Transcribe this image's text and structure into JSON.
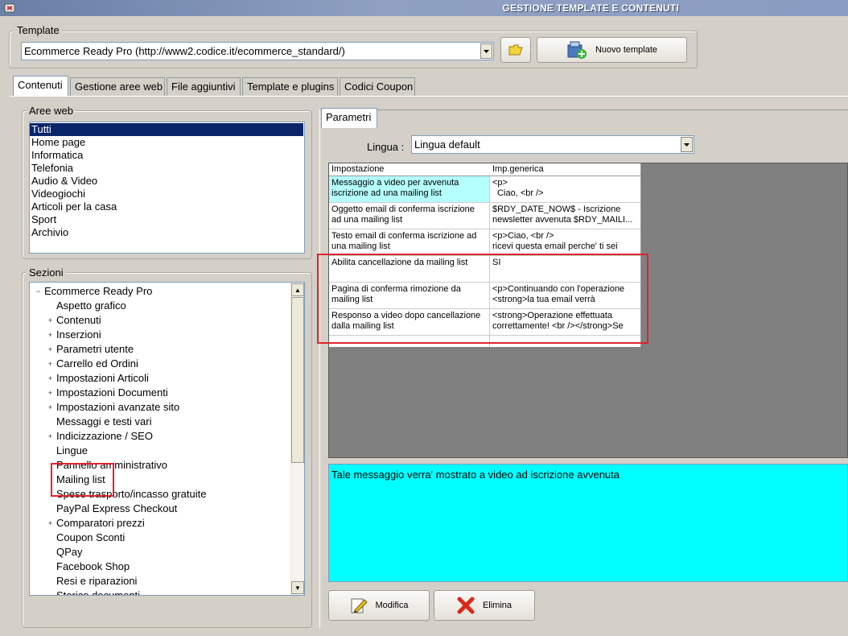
{
  "window": {
    "title": "GESTIONE TEMPLATE E CONTENUTI"
  },
  "template_group": {
    "label": "Template",
    "selected": "Ecommerce Ready Pro (http://www2.codice.it/ecommerce_standard/)",
    "new_button": "Nuovo template"
  },
  "tabs": [
    "Contenuti",
    "Gestione aree web",
    "File aggiuntivi",
    "Template e plugins",
    "Codici Coupon"
  ],
  "aree_web": {
    "label": "Aree web",
    "items": [
      "Tutti",
      "Home page",
      "Informatica",
      "Telefonia",
      "Audio & Video",
      "Videogiochi",
      "Articoli per la casa",
      "Sport",
      "Archivio"
    ]
  },
  "sezioni": {
    "label": "Sezioni",
    "root": "Ecommerce Ready Pro",
    "items": [
      {
        "label": "Aspetto grafico",
        "expand": ""
      },
      {
        "label": "Contenuti",
        "expand": "+"
      },
      {
        "label": "Inserzioni",
        "expand": "+"
      },
      {
        "label": "Parametri utente",
        "expand": "+"
      },
      {
        "label": "Carrello ed Ordini",
        "expand": "+"
      },
      {
        "label": "Impostazioni Articoli",
        "expand": "+"
      },
      {
        "label": "Impostazioni Documenti",
        "expand": "+"
      },
      {
        "label": "Impostazioni avanzate sito",
        "expand": "+"
      },
      {
        "label": "Messaggi e testi vari",
        "expand": ""
      },
      {
        "label": "Indicizzazione / SEO",
        "expand": "+"
      },
      {
        "label": "Lingue",
        "expand": ""
      },
      {
        "label": "Pannello amministrativo",
        "expand": ""
      },
      {
        "label": "Mailing list",
        "expand": ""
      },
      {
        "label": "Spese trasporto/incasso gratuite",
        "expand": ""
      },
      {
        "label": "PayPal Express Checkout",
        "expand": ""
      },
      {
        "label": "Comparatori prezzi",
        "expand": "+"
      },
      {
        "label": "Coupon Sconti",
        "expand": ""
      },
      {
        "label": "QPay",
        "expand": ""
      },
      {
        "label": "Facebook Shop",
        "expand": ""
      },
      {
        "label": "Resi e riparazioni",
        "expand": ""
      },
      {
        "label": "Storico documenti",
        "expand": ""
      }
    ]
  },
  "parametri": {
    "tab": "Parametri",
    "lingua_label": "Lingua :",
    "lingua_value": "Lingua default",
    "columns": [
      "Impostazione",
      "Imp.generica"
    ],
    "rows": [
      {
        "name": "Messaggio a video per avvenuta iscrizione ad una mailing list",
        "value": "<p>\n  Ciao, <br />"
      },
      {
        "name": "Oggetto email di conferma iscrizione ad una mailing list",
        "value": "$RDY_DATE_NOW$ - Iscrizione\nnewsletter avvenuta $RDY_MAILI..."
      },
      {
        "name": "Testo email di conferma iscrizione ad una mailing list",
        "value": "<p>Ciao, <br />\nricevi questa email perche' ti sei"
      },
      {
        "name": "Abilita cancellazione da mailing list",
        "value": "SI"
      },
      {
        "name": "Pagina di conferma rimozione da mailing list",
        "value": "<p>Continuando con l'operazione\n<strong>la tua email verrà"
      },
      {
        "name": "Responso a video dopo cancellazione dalla mailing list",
        "value": "<strong>Operazione effettuata\ncorrettamente! <br /></strong>Se"
      }
    ],
    "description": "Tale messaggio verra' mostrato a video ad iscrizione avvenuta",
    "modifica": "Modifica",
    "elimina": "Elimina"
  },
  "colors": {
    "selection": "#0a246a",
    "highlight": "#00ffff",
    "annotation": "#e0242e"
  }
}
